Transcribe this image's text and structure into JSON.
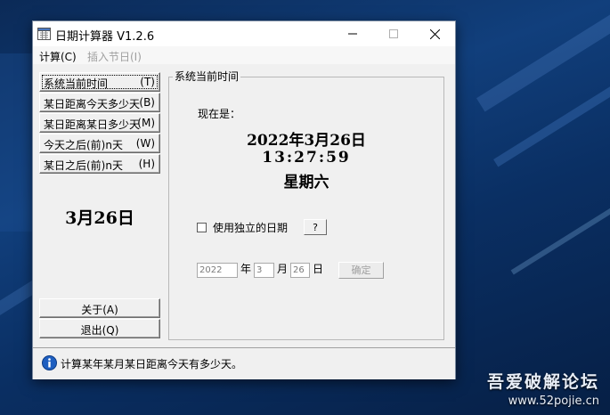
{
  "window": {
    "title": "日期计算器  V1.2.6"
  },
  "menu": {
    "items": [
      {
        "label": "计算(C)",
        "enabled": true
      },
      {
        "label": "插入节日(I)",
        "enabled": false
      }
    ]
  },
  "left_panel": {
    "buttons": [
      {
        "label": "系统当前时间",
        "key": "(T)"
      },
      {
        "label": "某日距离今天多少天",
        "key": "(B)"
      },
      {
        "label": "某日距离某日多少天",
        "key": "(M)"
      },
      {
        "label": "今天之后(前)n天",
        "key": "(W)"
      },
      {
        "label": "某日之后(前)n天",
        "key": "(H)"
      }
    ],
    "today": "3月26日",
    "about_label": "关于(A)",
    "exit_label": "退出(Q)"
  },
  "main_group": {
    "legend": "系统当前时间",
    "now_label": "现在是：",
    "date": "2022年3月26日",
    "time": "13:27:59",
    "weekday": "星期六",
    "checkbox_label": "使用独立的日期",
    "checkbox_checked": false,
    "help_label": "?",
    "year_value": "2022",
    "year_unit": "年",
    "month_value": "3",
    "month_unit": "月",
    "day_value": "26",
    "day_unit": "日",
    "confirm_label": "确定"
  },
  "status": {
    "text": "计算某年某月某日距离今天有多少天。"
  },
  "watermark": {
    "title": "吾爱破解论坛",
    "url": "www.52pojie.cn"
  }
}
